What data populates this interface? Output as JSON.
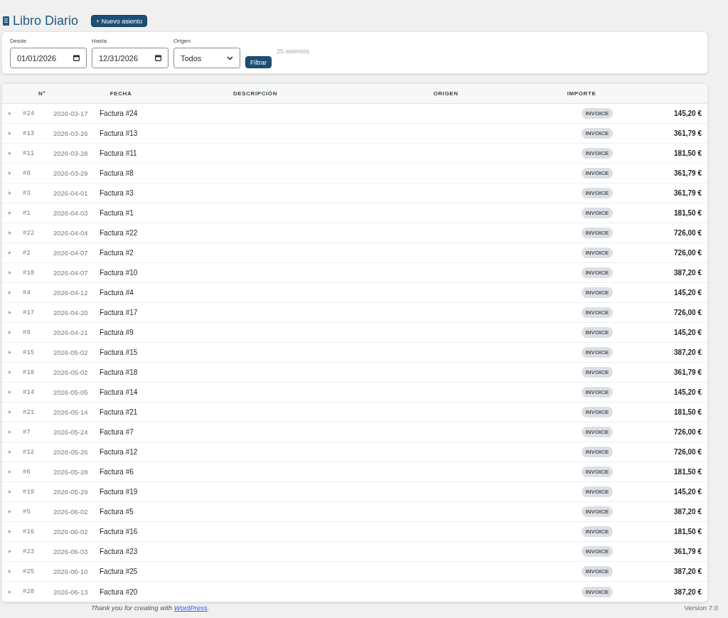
{
  "header": {
    "title": "Libro Diario",
    "new_button": "+ Nuevo asiento"
  },
  "filters": {
    "fields": [
      {
        "kind": "date",
        "label": "Desde",
        "value": "01/01/2026"
      },
      {
        "kind": "date",
        "label": "Hasta",
        "value": "12/31/2026"
      },
      {
        "kind": "select",
        "label": "Origen",
        "value": "Todos"
      }
    ],
    "submit": "Filtrar",
    "count": "25 asientos"
  },
  "table": {
    "columns": [
      "Nº",
      "FECHA",
      "DESCRIPCIÓN",
      "ORIGEN",
      "IMPORTE"
    ],
    "rows": [
      {
        "expanded": false,
        "number": "#24",
        "date": "2026-03-17",
        "description": "Factura #24",
        "origin": "INVOICE",
        "amount": "145,20 €"
      },
      {
        "expanded": false,
        "number": "#13",
        "date": "2026-03-26",
        "description": "Factura #13",
        "origin": "INVOICE",
        "amount": "361,79 €"
      },
      {
        "expanded": false,
        "number": "#11",
        "date": "2026-03-28",
        "description": "Factura #11",
        "origin": "INVOICE",
        "amount": "181,50 €"
      },
      {
        "expanded": false,
        "number": "#8",
        "date": "2026-03-29",
        "description": "Factura #8",
        "origin": "INVOICE",
        "amount": "361,79 €"
      },
      {
        "expanded": false,
        "number": "#3",
        "date": "2026-04-01",
        "description": "Factura #3",
        "origin": "INVOICE",
        "amount": "361,79 €"
      },
      {
        "expanded": false,
        "number": "#1",
        "date": "2026-04-03",
        "description": "Factura #1",
        "origin": "INVOICE",
        "amount": "181,50 €"
      },
      {
        "expanded": false,
        "number": "#22",
        "date": "2026-04-04",
        "description": "Factura #22",
        "origin": "INVOICE",
        "amount": "726,00 €"
      },
      {
        "expanded": false,
        "number": "#2",
        "date": "2026-04-07",
        "description": "Factura #2",
        "origin": "INVOICE",
        "amount": "726,00 €"
      },
      {
        "expanded": false,
        "number": "#10",
        "date": "2026-04-07",
        "description": "Factura #10",
        "origin": "INVOICE",
        "amount": "387,20 €"
      },
      {
        "expanded": false,
        "number": "#4",
        "date": "2026-04-12",
        "description": "Factura #4",
        "origin": "INVOICE",
        "amount": "145,20 €"
      },
      {
        "expanded": false,
        "number": "#17",
        "date": "2026-04-20",
        "description": "Factura #17",
        "origin": "INVOICE",
        "amount": "726,00 €"
      },
      {
        "expanded": false,
        "number": "#9",
        "date": "2026-04-21",
        "description": "Factura #9",
        "origin": "INVOICE",
        "amount": "145,20 €"
      },
      {
        "expanded": false,
        "number": "#15",
        "date": "2026-05-02",
        "description": "Factura #15",
        "origin": "INVOICE",
        "amount": "387,20 €"
      },
      {
        "expanded": false,
        "number": "#18",
        "date": "2026-05-02",
        "description": "Factura #18",
        "origin": "INVOICE",
        "amount": "361,79 €"
      },
      {
        "expanded": false,
        "number": "#14",
        "date": "2026-05-05",
        "description": "Factura #14",
        "origin": "INVOICE",
        "amount": "145,20 €"
      },
      {
        "expanded": false,
        "number": "#21",
        "date": "2026-05-14",
        "description": "Factura #21",
        "origin": "INVOICE",
        "amount": "181,50 €"
      },
      {
        "expanded": false,
        "number": "#7",
        "date": "2026-05-24",
        "description": "Factura #7",
        "origin": "INVOICE",
        "amount": "726,00 €"
      },
      {
        "expanded": false,
        "number": "#12",
        "date": "2026-05-26",
        "description": "Factura #12",
        "origin": "INVOICE",
        "amount": "726,00 €"
      },
      {
        "expanded": false,
        "number": "#6",
        "date": "2026-05-28",
        "description": "Factura #6",
        "origin": "INVOICE",
        "amount": "181,50 €"
      },
      {
        "expanded": false,
        "number": "#19",
        "date": "2026-05-29",
        "description": "Factura #19",
        "origin": "INVOICE",
        "amount": "145,20 €"
      },
      {
        "expanded": false,
        "number": "#5",
        "date": "2026-06-02",
        "description": "Factura #5",
        "origin": "INVOICE",
        "amount": "387,20 €"
      },
      {
        "expanded": false,
        "number": "#16",
        "date": "2026-06-02",
        "description": "Factura #16",
        "origin": "INVOICE",
        "amount": "181,50 €"
      },
      {
        "expanded": false,
        "number": "#23",
        "date": "2026-06-03",
        "description": "Factura #23",
        "origin": "INVOICE",
        "amount": "361,79 €"
      },
      {
        "expanded": false,
        "number": "#25",
        "date": "2026-06-10",
        "description": "Factura #25",
        "origin": "INVOICE",
        "amount": "387,20 €"
      },
      {
        "expanded": false,
        "number": "#20",
        "date": "2026-06-13",
        "description": "Factura #20",
        "origin": "INVOICE",
        "amount": "387,20 €"
      }
    ]
  },
  "footer": {
    "credit_before": "Thank you for creating with",
    "credit_link": "WordPress",
    "credit_after": ".",
    "version": "Version 7.0"
  }
}
